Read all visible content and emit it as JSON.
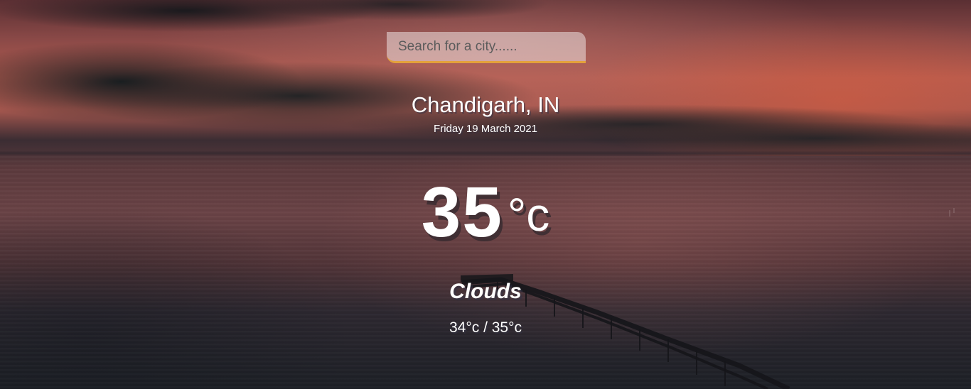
{
  "search": {
    "placeholder": "Search for a city......",
    "value": "",
    "underline_color": "#e3a13c"
  },
  "location": {
    "city_country": "Chandigarh, IN",
    "date": "Friday 19 March 2021"
  },
  "temperature": {
    "value": "35",
    "unit": "°c"
  },
  "weather": {
    "condition": "Clouds",
    "hi_low": "34°c / 35°c"
  },
  "background": {
    "scene": "sunset-sea-with-pier"
  }
}
